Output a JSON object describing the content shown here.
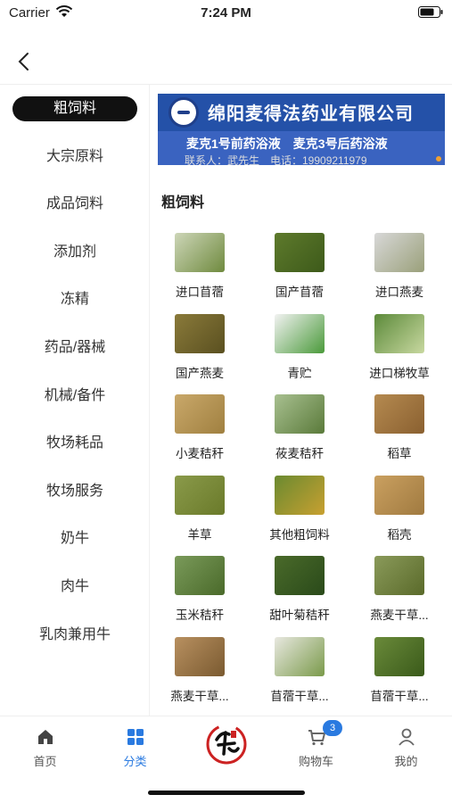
{
  "status_bar": {
    "carrier": "Carrier",
    "time": "7:24 PM"
  },
  "sidebar": {
    "items": [
      {
        "label": "粗饲料",
        "active": true
      },
      {
        "label": "大宗原料"
      },
      {
        "label": "成品饲料"
      },
      {
        "label": "添加剂"
      },
      {
        "label": "冻精"
      },
      {
        "label": "药品/器械"
      },
      {
        "label": "机械/备件"
      },
      {
        "label": "牧场耗品"
      },
      {
        "label": "牧场服务"
      },
      {
        "label": "奶牛"
      },
      {
        "label": "肉牛"
      },
      {
        "label": "乳肉兼用牛"
      }
    ]
  },
  "banner": {
    "company": "绵阳麦得法药业有限公司",
    "products": "麦克1号前药浴液　麦克3号后药浴液",
    "contact": "联系人：武先生　电话：19909211979"
  },
  "section_title": "粗饲料",
  "products": [
    {
      "label": "进口苜蓿",
      "color": "#cdd6b8",
      "accent": "#6f8a3e"
    },
    {
      "label": "国产苜蓿",
      "color": "#5e7a2c",
      "accent": "#3d5a1a"
    },
    {
      "label": "进口燕麦",
      "color": "#d8d8d8",
      "accent": "#9aa07a"
    },
    {
      "label": "国产燕麦",
      "color": "#8a7a3a",
      "accent": "#5a5020"
    },
    {
      "label": "青贮",
      "color": "#f2f2f2",
      "accent": "#4a9a3a"
    },
    {
      "label": "进口梯牧草",
      "color": "#5c8a3a",
      "accent": "#c8d8a0"
    },
    {
      "label": "小麦秸秆",
      "color": "#c9a86a",
      "accent": "#a08040"
    },
    {
      "label": "莜麦秸秆",
      "color": "#a8c090",
      "accent": "#5a7a3a"
    },
    {
      "label": "稻草",
      "color": "#b58a50",
      "accent": "#8a6030"
    },
    {
      "label": "羊草",
      "color": "#8a9a4a",
      "accent": "#6a7a2a"
    },
    {
      "label": "其他粗饲料",
      "color": "#6a8a30",
      "accent": "#c8a030"
    },
    {
      "label": "稻壳",
      "color": "#caa060",
      "accent": "#a07a40"
    },
    {
      "label": "玉米秸秆",
      "color": "#7a9a5a",
      "accent": "#4a6a2a"
    },
    {
      "label": "甜叶菊秸秆",
      "color": "#4a6a2a",
      "accent": "#2a4a1a"
    },
    {
      "label": "燕麦干草...",
      "color": "#8a9a5a",
      "accent": "#5a6a2a"
    },
    {
      "label": "燕麦干草...",
      "color": "#b89060",
      "accent": "#7a5a30"
    },
    {
      "label": "苜蓿干草...",
      "color": "#e8e8e0",
      "accent": "#7a9a4a"
    },
    {
      "label": "苜蓿干草...",
      "color": "#6a8a3a",
      "accent": "#3a5a1a"
    }
  ],
  "tab_bar": {
    "tabs": [
      {
        "label": "首页",
        "icon": "home-icon"
      },
      {
        "label": "分类",
        "icon": "category-grid-icon",
        "active": true
      },
      {
        "label": "",
        "icon": "brand-logo"
      },
      {
        "label": "购物车",
        "icon": "shopping-cart-icon",
        "badge": "3"
      },
      {
        "label": "我的",
        "icon": "person-icon"
      }
    ]
  }
}
